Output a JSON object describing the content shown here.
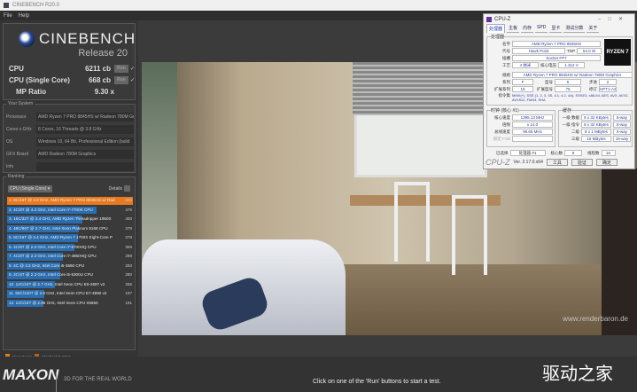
{
  "window": {
    "title": "CINEBENCH R20.0"
  },
  "menu": [
    "File",
    "Help"
  ],
  "logo": {
    "brand": "CINEBENCH",
    "release": "Release 20"
  },
  "scores": [
    {
      "label": "CPU",
      "value": "6211 cb",
      "run": "Run"
    },
    {
      "label": "CPU (Single Core)",
      "value": "668 cb",
      "run": "Run"
    },
    {
      "label": "MP Ratio",
      "value": "9.30 x"
    }
  ],
  "system": {
    "title": "Your System",
    "rows": [
      {
        "k": "Processor",
        "v": "AMD Ryzen 7 PRO 8845HS w/ Radeon 780M Gra"
      },
      {
        "k": "Cores x GHz",
        "v": "8 Cores, 16 Threads @ 3.8 GHz"
      },
      {
        "k": "OS",
        "v": "Windows 10, 64 Bit, Professional Edition (build"
      },
      {
        "k": "GFX Board",
        "v": "AMD Radeon 780M Graphics"
      },
      {
        "k": "Info",
        "v": ""
      }
    ]
  },
  "ranking": {
    "title": "Ranking",
    "dropdown": "CPU (Single Core)",
    "details": "Details",
    "items": [
      {
        "t": "1. 8C/16T @ 3.8 GHz, AMD Ryzen 7 PRO 8845HS w/ Rad",
        "s": 668,
        "me": true
      },
      {
        "t": "2. 4C/8T @ 4.2 GHz, Intel Core i7-7700K CPU",
        "s": 475
      },
      {
        "t": "3. 16C/32T @ 3.4 GHz, AMD Ryzen Threadripper 1950X",
        "s": 400
      },
      {
        "t": "4. 48C/96T @ 2.7 GHz, Intel Xeon Platinum 8168 CPU",
        "s": 379
      },
      {
        "t": "5. 8C/16T @ 3.4 GHz, AMD Ryzen 7 1700X Eight-Core P",
        "s": 378
      },
      {
        "t": "6. 4C/8T @ 2.6 GHz, Intel Core i7-6700HQ CPU",
        "s": 359
      },
      {
        "t": "7. 4C/8T @ 2.3 GHz, Intel Core i7-4850HQ CPU",
        "s": 298
      },
      {
        "t": "8. 4C @ 3.3 GHz, Intel Core i5-3550 CPU",
        "s": 283
      },
      {
        "t": "9. 2C/4T @ 2.3 GHz, Intel Core i5-5300U CPU",
        "s": 280
      },
      {
        "t": "10. 12C/24T @ 2.7 GHz, Intel Xeon CPU E5-2697 v2",
        "s": 255
      },
      {
        "t": "11. 60C/120T @ 2.8 GHz, Intel Xeon CPU E7-4890 v2",
        "s": 197
      },
      {
        "t": "12. 12C/24T @ 2.66 GHz, Intel Xeon CPU X5650",
        "s": 191
      }
    ]
  },
  "legend": {
    "your_score": "Your Score",
    "identical": "Identical System"
  },
  "footer": {
    "brand": "MAXON",
    "tagline": "3D FOR THE REAL WORLD",
    "status": "Click on one of the 'Run' buttons to start a test.",
    "watermark": "驱动之家"
  },
  "render": {
    "credit": "www.renderbaron.de"
  },
  "cpuz": {
    "title": "CPU-Z",
    "tabs": [
      "处理器",
      "主板",
      "内存",
      "SPD",
      "显卡",
      "测试分数",
      "关于"
    ],
    "group_proc": "处理器",
    "name": "AMD Ryzen 7 PRO 8845HS",
    "code": "Hawk Point",
    "tdp_label": "TDP",
    "tdp": "54.0 W",
    "socket": "Socket FP7",
    "tech": "4 纳米",
    "volt_label": "核心电压",
    "volt": "1.312 V",
    "spec": "AMD Ryzen 7 PRO 8845HS w/ Radeon 780M Graphics",
    "family": "F",
    "model": "5",
    "stepping": "2",
    "ext_family": "19",
    "ext_model": "75",
    "revision": "HPT1-A2",
    "instr": "MMX(+), SSE (1, 2, 3, 3S, 4.1, 4.2, 4A), SSSE3, x86-64, AES, AVX, AVX2, AVX512, FMA3, SHA",
    "labels": {
      "name": "名字",
      "code": "代号",
      "socket": "插槽",
      "tech": "工艺",
      "spec": "规格",
      "family": "系列",
      "model": "型号",
      "stepping": "步进",
      "ext_family": "扩展系列",
      "ext_model": "扩展型号",
      "revision": "修订",
      "instr": "指令集"
    },
    "clock_group": "时钟 (核心 #1)",
    "core_speed_l": "核心速度",
    "core_speed": "1395.13 MHz",
    "mult_l": "倍频",
    "mult": "x 14.0",
    "bus_l": "总线速度",
    "bus": "99.65 MHz",
    "fsb_l": "额定 FSB",
    "cache_group": "缓存",
    "cache": [
      {
        "l": "一级 数据",
        "v": "8 x 32 KBytes",
        "w": "8-way"
      },
      {
        "l": "一级 指令",
        "v": "8 x 32 KBytes",
        "w": "8-way"
      },
      {
        "l": "二级",
        "v": "8 x 1 MBytes",
        "w": "8-way"
      },
      {
        "l": "三级",
        "v": "16 MBytes",
        "w": "16-way"
      }
    ],
    "sel_l": "已选择",
    "sel": "处理器 #1",
    "cores_l": "核心数",
    "cores": "8",
    "threads_l": "线程数",
    "threads": "16",
    "brand": "CPU-Z",
    "version": "Ver. 2.17.0.x64",
    "tools": "工具",
    "validate": "验证",
    "ok": "确定",
    "logo": "RYZEN 7"
  }
}
